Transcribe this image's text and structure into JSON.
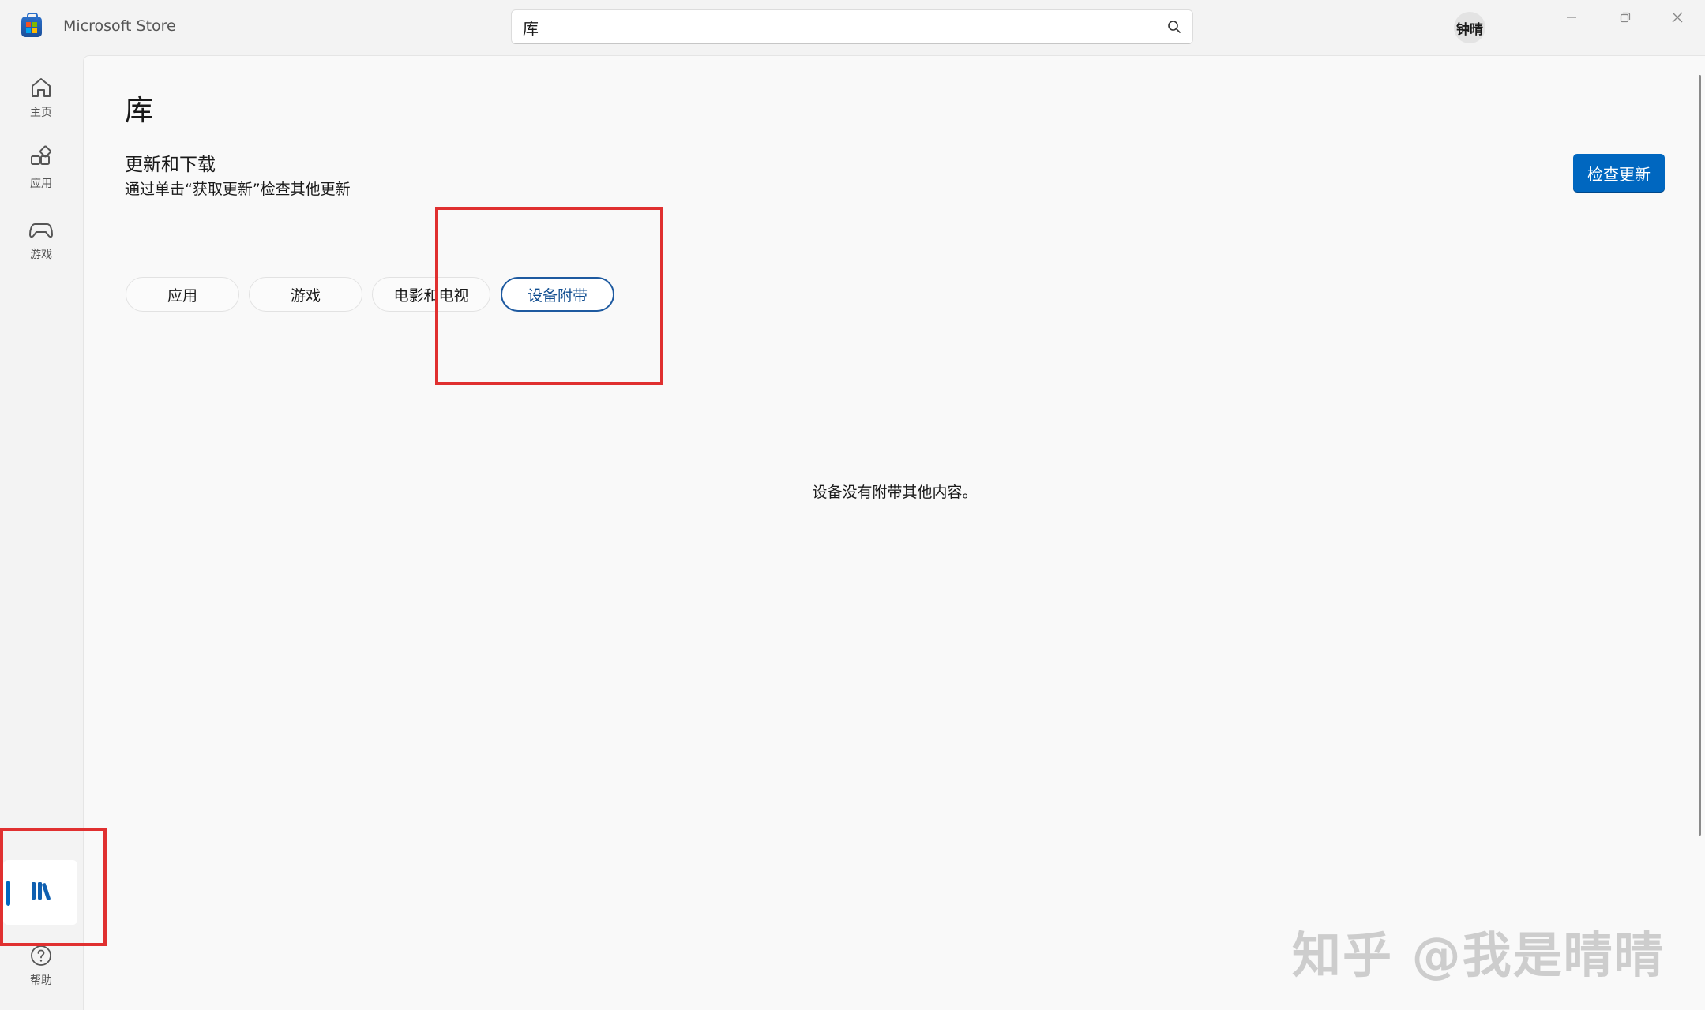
{
  "window": {
    "app_title": "Microsoft Store",
    "search_value": "库",
    "avatar_text": "钟晴"
  },
  "rail": {
    "home_label": "主页",
    "apps_label": "应用",
    "games_label": "游戏",
    "help_label": "帮助"
  },
  "main": {
    "page_title": "库",
    "section_title": "更新和下载",
    "section_desc": "通过单击“获取更新”检查其他更新",
    "check_updates_label": "检查更新",
    "filters": [
      "应用",
      "游戏",
      "电影和电视",
      "设备附带"
    ],
    "active_filter": "设备附带",
    "empty_message": "设备没有附带其他内容。"
  },
  "watermark": "知乎 @我是晴晴",
  "colors": {
    "accent": "#0067c0",
    "annotation": "#e03030"
  }
}
